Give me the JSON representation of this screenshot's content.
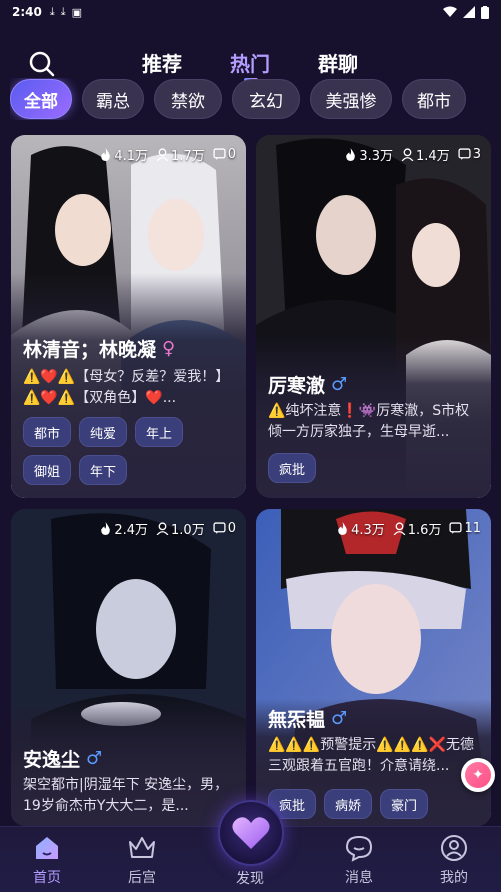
{
  "status_bar": {
    "time": "2:40"
  },
  "top_tabs": [
    {
      "label": "推荐",
      "active": false
    },
    {
      "label": "热门",
      "active": true
    },
    {
      "label": "群聊",
      "active": false
    }
  ],
  "categories": [
    {
      "label": "全部",
      "active": true
    },
    {
      "label": "霸总",
      "active": false
    },
    {
      "label": "禁欲",
      "active": false
    },
    {
      "label": "玄幻",
      "active": false
    },
    {
      "label": "美强惨",
      "active": false
    },
    {
      "label": "都市",
      "active": false
    }
  ],
  "cards": [
    {
      "heat": "4.1万",
      "followers": "1.7万",
      "comments": "0",
      "name": "林清音；林晚凝",
      "gender": "♀",
      "desc": "⚠️❤️⚠️【母女？反差？爱我！】⚠️❤️⚠️【双角色】❤️...",
      "tags": [
        "都市",
        "纯爱",
        "年上",
        "御姐",
        "年下"
      ]
    },
    {
      "heat": "3.3万",
      "followers": "1.4万",
      "comments": "3",
      "name": "厉寒澈",
      "gender": "♂",
      "desc": "⚠️纯坏注意❗👾厉寒澈，S市权倾一方厉家独子，生母早逝...",
      "tags": [
        "疯批"
      ]
    },
    {
      "heat": "2.4万",
      "followers": "1.0万",
      "comments": "0",
      "name": "安逸尘",
      "gender": "♂",
      "desc": "架空都市|阴湿年下 安逸尘，男，19岁俞杰市Y大大二，是...",
      "tags": []
    },
    {
      "heat": "4.3万",
      "followers": "1.6万",
      "comments": "11",
      "name": "無炁韫",
      "gender": "♂",
      "desc": "⚠️⚠️⚠️预警提示⚠️⚠️⚠️❌无德三观跟着五官跑！介意请绕...",
      "tags": [
        "疯批",
        "病娇",
        "豪门"
      ]
    }
  ],
  "bottom_nav": [
    {
      "label": "首页",
      "icon": "home-icon",
      "active": true
    },
    {
      "label": "后宫",
      "icon": "crown-icon",
      "active": false
    },
    {
      "label": "发现",
      "icon": "heart-icon",
      "active": false
    },
    {
      "label": "消息",
      "icon": "chat-icon",
      "active": false
    },
    {
      "label": "我的",
      "icon": "user-icon",
      "active": false
    }
  ],
  "colors": {
    "background": "#17112e",
    "accent": "#b59cff",
    "tag_bg": "#3a3e7a"
  }
}
